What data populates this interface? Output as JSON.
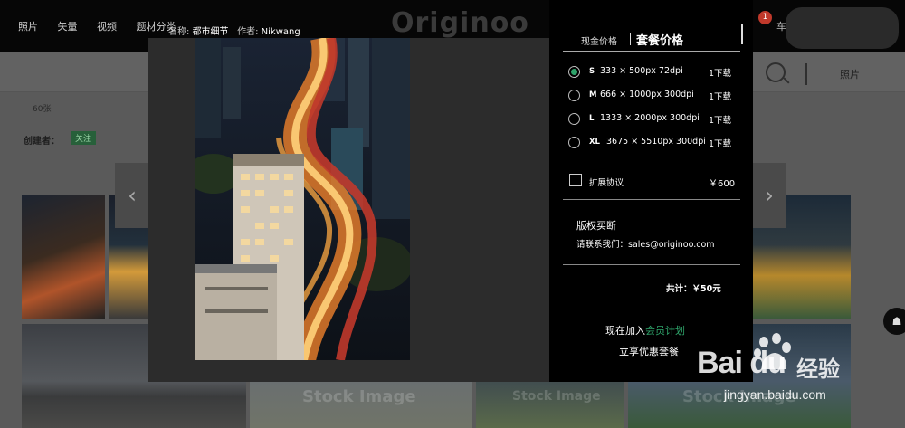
{
  "topbar": {
    "nav": [
      "照片",
      "矢量",
      "视频",
      "题材分类"
    ],
    "logo": "Originoo",
    "cart_badge": "1",
    "cart_label": "车"
  },
  "searchbar": {
    "scope": "照片"
  },
  "gallery": {
    "count": "60张",
    "creator_label": "创建者：",
    "follow_label": "关注",
    "watermark": "Stock Image"
  },
  "modal": {
    "name_label": "名称:",
    "name_value": "都市细节",
    "author_label": "作者:",
    "author_value": "Nikwang",
    "tabs": [
      "现金价格",
      "套餐价格"
    ],
    "active_tab": "套餐价格",
    "options": [
      {
        "size": "S",
        "dims": "333 × 500px 72dpi",
        "downloads": "1下载",
        "selected": true
      },
      {
        "size": "M",
        "dims": "666 × 1000px 300dpi",
        "downloads": "1下载",
        "selected": false
      },
      {
        "size": "L",
        "dims": "1333 × 2000px 300dpi",
        "downloads": "1下载",
        "selected": false
      },
      {
        "size": "XL",
        "dims": "3675 × 5510px 300dpi",
        "downloads": "1下载",
        "selected": false
      }
    ],
    "extended_license": {
      "label": "扩展协议",
      "price": "￥600",
      "checked": false
    },
    "buyout": {
      "title": "版权买断",
      "contact": "请联系我们：sales@originoo.com"
    },
    "total": "共计：￥50元",
    "join_prefix": "现在加入",
    "join_link": "会员计划",
    "perk": "立享优惠套餐"
  },
  "watermark": {
    "brand": "Bai du",
    "brand_cn": "经验",
    "url": "jingyan.baidu.com"
  },
  "colors": {
    "accent_green": "#2ea36a",
    "badge_red": "#c0392b"
  }
}
